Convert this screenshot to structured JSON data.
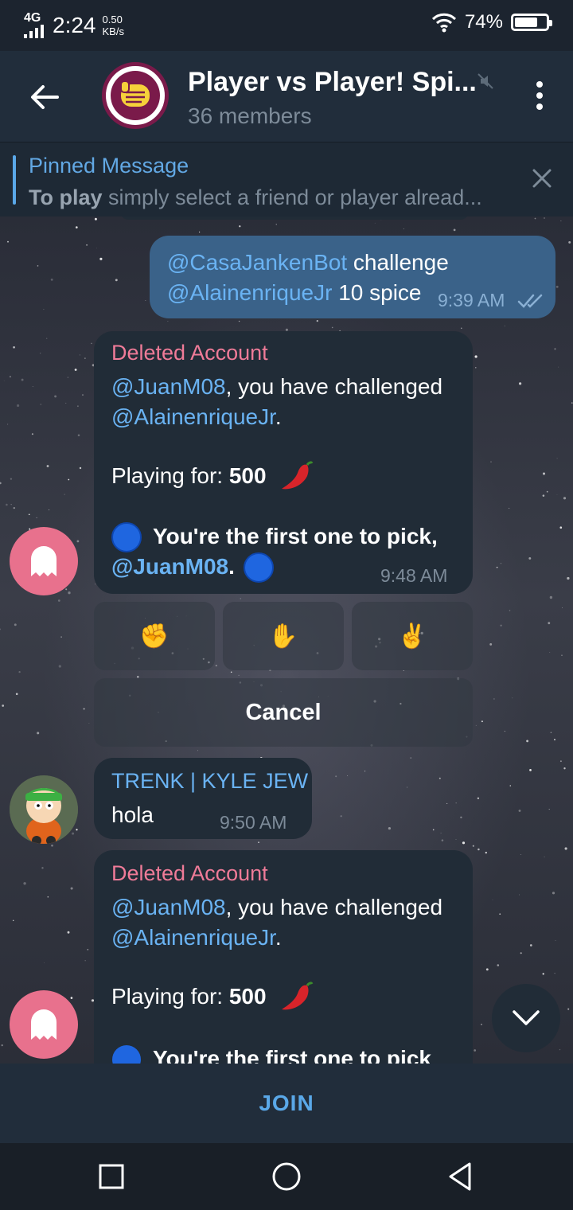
{
  "status_bar": {
    "network": "4G",
    "time": "2:24",
    "speed_value": "0.50",
    "speed_unit": "KB/s",
    "battery": "74%",
    "battery_level": 0.74
  },
  "header": {
    "title": "Player vs Player! Spi...",
    "subtitle": "36 members"
  },
  "pinned": {
    "title": "Pinned Message",
    "text_bold": "To play",
    "text_rest": " simply select a friend or player alread..."
  },
  "messages": {
    "outgoing": {
      "line1_mention": "@CasaJankenBot",
      "line1_text": " challenge",
      "line2_mention": "@AlainenriqueJr",
      "line2_text": " 10 spice",
      "time": "9:39 AM"
    },
    "bot1": {
      "sender": "Deleted Account",
      "mention1": "@JuanM08",
      "text1": ", you have challenged",
      "mention2": "@AlainenriqueJr",
      "dot": ".",
      "playing_label": "Playing for: ",
      "playing_value": "500",
      "pick_text": "You're the first one to pick,",
      "mention3": "@JuanM08",
      "time": "9:48 AM"
    },
    "keyboard": {
      "rock": "✊",
      "paper": "✋",
      "scissors": "✌️",
      "cancel": "Cancel"
    },
    "user": {
      "sender": "TRENK | KYLE JEW",
      "text": "hola",
      "time": "9:50 AM"
    },
    "bot2": {
      "sender": "Deleted Account",
      "mention1": "@JuanM08",
      "text1": ", you have challenged",
      "mention2": "@AlainenriqueJr",
      "dot": ".",
      "playing_label": "Playing for: ",
      "playing_value": "500",
      "pick_text": "You're the first one to pick"
    }
  },
  "join_label": "JOIN",
  "colors": {
    "accent": "#5aa8e8",
    "mention": "#6ab3f3",
    "deleted_sender": "#ef7b98",
    "bubble_in": "#212c37",
    "bubble_out": "#3a6289"
  }
}
